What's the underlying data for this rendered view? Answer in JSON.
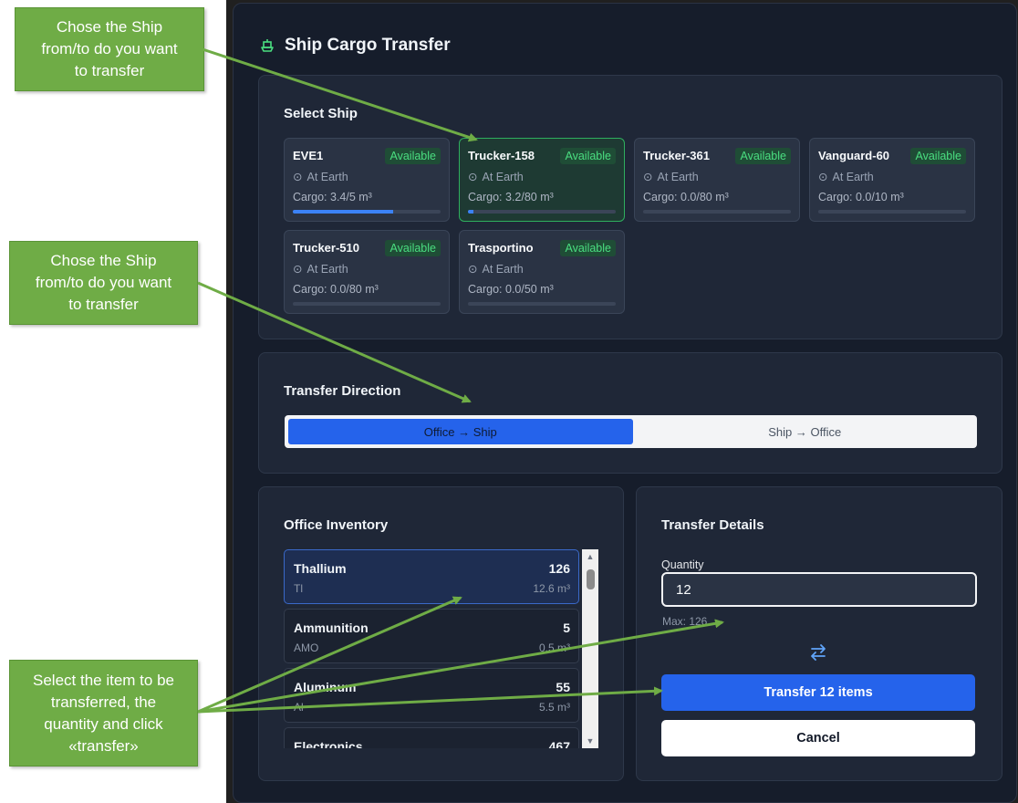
{
  "modal": {
    "title": "Ship Cargo Transfer",
    "icon": "ship-icon"
  },
  "select_ship": {
    "heading": "Select Ship",
    "ships": [
      {
        "name": "EVE1",
        "status": "Available",
        "location": "At Earth",
        "cargo": "Cargo: 3.4/5 m³",
        "fill": 0.68,
        "selected": false
      },
      {
        "name": "Trucker-158",
        "status": "Available",
        "location": "At Earth",
        "cargo": "Cargo: 3.2/80 m³",
        "fill": 0.04,
        "selected": true
      },
      {
        "name": "Trucker-361",
        "status": "Available",
        "location": "At Earth",
        "cargo": "Cargo: 0.0/80 m³",
        "fill": 0,
        "selected": false
      },
      {
        "name": "Vanguard-60",
        "status": "Available",
        "location": "At Earth",
        "cargo": "Cargo: 0.0/10 m³",
        "fill": 0,
        "selected": false
      },
      {
        "name": "Trucker-510",
        "status": "Available",
        "location": "At Earth",
        "cargo": "Cargo: 0.0/80 m³",
        "fill": 0,
        "selected": false
      },
      {
        "name": "Trasportino",
        "status": "Available",
        "location": "At Earth",
        "cargo": "Cargo: 0.0/50 m³",
        "fill": 0,
        "selected": false
      }
    ]
  },
  "direction": {
    "heading": "Transfer Direction",
    "options": [
      "Office → Ship",
      "Ship → Office"
    ],
    "active": "Office → Ship"
  },
  "inventory": {
    "heading": "Office Inventory",
    "items": [
      {
        "name": "Thallium",
        "code": "Tl",
        "qty": "126",
        "volume": "12.6 m³",
        "selected": true
      },
      {
        "name": "Ammunition",
        "code": "AMO",
        "qty": "5",
        "volume": "0.5 m³",
        "selected": false
      },
      {
        "name": "Aluminum",
        "code": "Al",
        "qty": "55",
        "volume": "5.5 m³",
        "selected": false
      },
      {
        "name": "Electronics",
        "code": "",
        "qty": "467",
        "volume": "",
        "selected": false
      }
    ]
  },
  "details": {
    "heading": "Transfer Details",
    "quantity_label": "Quantity",
    "quantity_value": "12",
    "max_text": "Max: 126",
    "transfer_label": "Transfer 12 items",
    "cancel_label": "Cancel"
  },
  "callouts": {
    "one": [
      "Chose the Ship",
      "from/to do you want",
      "to transfer"
    ],
    "two": [
      "Chose the Ship",
      "from/to do you want",
      "to transfer"
    ],
    "three": [
      "Select the item to be",
      "transferred, the",
      "quantity and click",
      "«transfer»"
    ]
  },
  "colors": {
    "accent": "#2563eb",
    "available": "#4ade80",
    "callout": "#6fac46",
    "panel": "#1f2737"
  }
}
